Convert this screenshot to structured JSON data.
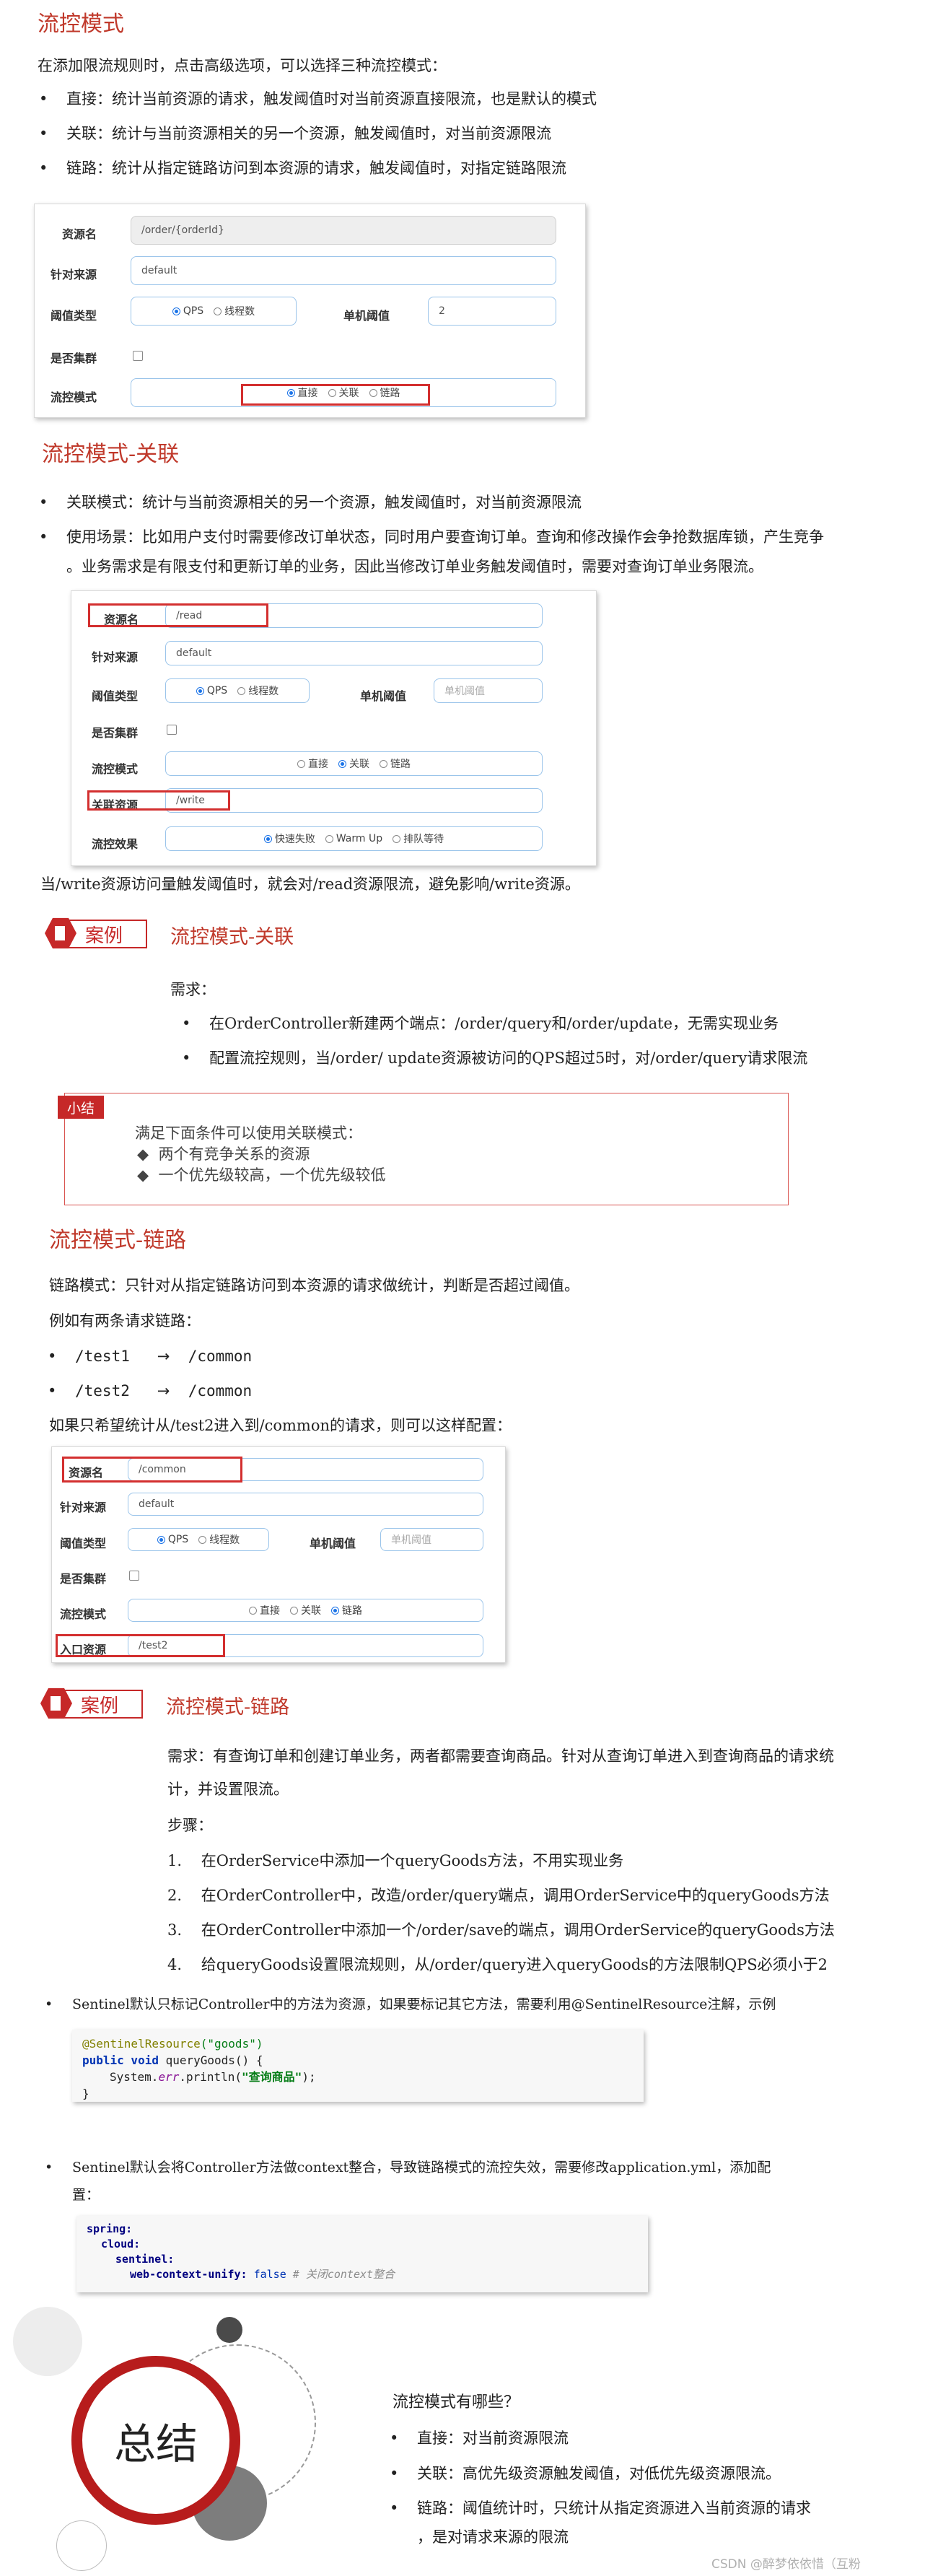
{
  "s1": {
    "title": "流控模式",
    "intro": "在添加限流规则时，点击高级选项，可以选择三种流控模式：",
    "bullets": [
      "直接：统计当前资源的请求，触发阈值时对当前资源直接限流，也是默认的模式",
      "关联：统计与当前资源相关的另一个资源，触发阈值时，对当前资源限流",
      "链路：统计从指定链路访问到本资源的请求，触发阈值时，对指定链路限流"
    ]
  },
  "form1": {
    "labels": {
      "resource": "资源名",
      "origin": "针对来源",
      "grade": "阈值类型",
      "count": "单机阈值",
      "cluster": "是否集群",
      "strategy": "流控模式"
    },
    "resource": "/order/{orderId}",
    "origin": "default",
    "count": "2",
    "grade": [
      "QPS",
      "线程数"
    ],
    "strategy": [
      "直接",
      "关联",
      "链路"
    ]
  },
  "s2": {
    "title": "流控模式-关联",
    "bullets": [
      "关联模式：统计与当前资源相关的另一个资源，触发阈值时，对当前资源限流",
      "使用场景：比如用户支付时需要修改订单状态，同时用户要查询订单。查询和修改操作会争抢数据库锁，产生竞争",
      "。业务需求是有限支付和更新订单的业务，因此当修改订单业务触发阈值时，需要对查询订单业务限流。"
    ]
  },
  "form2": {
    "labels": {
      "resource": "资源名",
      "origin": "针对来源",
      "grade": "阈值类型",
      "count": "单机阈值",
      "cluster": "是否集群",
      "strategy": "流控模式",
      "ref": "关联资源",
      "effect": "流控效果"
    },
    "resource": "/read",
    "origin": "default",
    "count_placeholder": "单机阈值",
    "ref": "/write",
    "grade": [
      "QPS",
      "线程数"
    ],
    "strategy": [
      "直接",
      "关联",
      "链路"
    ],
    "effect": [
      "快速失败",
      "Warm Up",
      "排队等待"
    ]
  },
  "s2_note": "当/write资源访问量触发阈值时，就会对/read资源限流，避免影响/write资源。",
  "case1": {
    "badge": "案例",
    "title": "流控模式-关联",
    "need": "需求：",
    "items": [
      "在OrderController新建两个端点：/order/query和/order/update，无需实现业务",
      "配置流控规则，当/order/ update资源被访问的QPS超过5时，对/order/query请求限流"
    ]
  },
  "summary_box": {
    "tag": "小结",
    "intro": "满足下面条件可以使用关联模式：",
    "items": [
      "两个有竞争关系的资源",
      "一个优先级较高，一个优先级较低"
    ]
  },
  "s3": {
    "title": "流控模式-链路",
    "p1": "链路模式：只针对从指定链路访问到本资源的请求做统计，判断是否超过阈值。",
    "p2": "例如有两条请求链路：",
    "chains": [
      {
        "from": "/test1",
        "to": "/common"
      },
      {
        "from": "/test2",
        "to": "/common"
      }
    ],
    "arrow": "→",
    "p3": "如果只希望统计从/test2进入到/common的请求，则可以这样配置："
  },
  "form3": {
    "labels": {
      "resource": "资源名",
      "origin": "针对来源",
      "grade": "阈值类型",
      "count": "单机阈值",
      "cluster": "是否集群",
      "strategy": "流控模式",
      "entry": "入口资源"
    },
    "resource": "/common",
    "origin": "default",
    "count_placeholder": "单机阈值",
    "entry": "/test2",
    "grade": [
      "QPS",
      "线程数"
    ],
    "strategy": [
      "直接",
      "关联",
      "链路"
    ]
  },
  "case2": {
    "badge": "案例",
    "title": "流控模式-链路",
    "need1": "需求：有查询订单和创建订单业务，两者都需要查询商品。针对从查询订单进入到查询商品的请求统",
    "need2": "计，并设置限流。",
    "steps_label": "步骤：",
    "steps": [
      {
        "n": "1.",
        "t": "在OrderService中添加一个queryGoods方法，不用实现业务"
      },
      {
        "n": "2.",
        "t": "在OrderController中，改造/order/query端点，调用OrderService中的queryGoods方法"
      },
      {
        "n": "3.",
        "t": "在OrderController中添加一个/order/save的端点，调用OrderService的queryGoods方法"
      },
      {
        "n": "4.",
        "t": "给queryGoods设置限流规则，从/order/query进入queryGoods的方法限制QPS必须小于2"
      }
    ]
  },
  "tip1": "Sentinel默认只标记Controller中的方法为资源，如果要标记其它方法，需要利用@SentinelResource注解，示例",
  "code1": {
    "annotation": "@SentinelResource",
    "annotation_arg": "(\"goods\")",
    "sig_kw": "public void",
    "sig_rest": " queryGoods() {",
    "body_pre": "System.",
    "body_err": "err",
    "body_mid": ".println(",
    "body_str": "\"查询商品\"",
    "body_end": ");",
    "close": "}"
  },
  "tip2a": "Sentinel默认会将Controller方法做context整合，导致链路模式的流控失效，需要修改application.yml，添加配",
  "tip2b": "置：",
  "code2": {
    "l1": "spring:",
    "l2": "cloud:",
    "l3": "sentinel:",
    "l4_key": "web-context-unify:",
    "l4_val": " false ",
    "l4_comment": "# 关闭context整合"
  },
  "final": {
    "circle": "总结",
    "q": "流控模式有哪些？",
    "items": [
      "直接：对当前资源限流",
      "关联：高优先级资源触发阈值，对低优先级资源限流。",
      "链路：阈值统计时，只统计从指定资源进入当前资源的请求"
    ],
    "item3b": "，是对请求来源的限流"
  },
  "watermark": "CSDN @醉梦依依惜（互粉",
  "colors": {
    "heading": "#c0392b",
    "badge": "#c62828",
    "highlight": "#d32f2f",
    "input_border": "#9ac4ea",
    "radio": "#1a73e8"
  }
}
